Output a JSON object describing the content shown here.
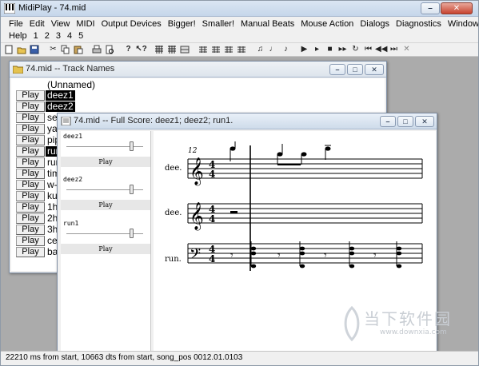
{
  "app": {
    "title": "MidiPlay - 74.mid",
    "colors": {
      "window_frame": "#c5d6ea",
      "mdi_background": "#ababab",
      "selection": "#000000"
    }
  },
  "menu": {
    "row1": [
      "File",
      "Edit",
      "View",
      "MIDI",
      "Output Devices",
      "Bigger!",
      "Smaller!",
      "Manual Beats",
      "Mouse Action",
      "Dialogs",
      "Diagnostics",
      "Window"
    ],
    "row2": [
      "Help",
      "1",
      "2",
      "3",
      "4",
      "5"
    ]
  },
  "toolbar": {
    "icons": [
      "new-icon",
      "open-icon",
      "save-icon",
      "cut-icon",
      "copy-icon",
      "paste-icon",
      "print-icon",
      "print-preview-icon",
      "help-icon",
      "context-help-icon",
      "piano-roll-icon",
      "score-icon",
      "staff-icon",
      "stave-icon",
      "bars-icon",
      "beats-icon",
      "notes-icon",
      "tempo-icon",
      "key-icon",
      "clef-icon",
      "play-icon",
      "step-forward-icon",
      "stop-icon",
      "fast-forward-icon",
      "loop-icon",
      "rewind-start-icon",
      "rewind-icon",
      "forward-end-icon",
      "close-icon"
    ]
  },
  "track_window": {
    "title": "74.mid -- Track Names",
    "play_label": "Play",
    "header": "(Unnamed)",
    "tracks": [
      {
        "name": "deez1",
        "selected": true
      },
      {
        "name": "deez2",
        "selected": true
      },
      {
        "name": "ser",
        "selected": false
      },
      {
        "name": "yac",
        "selected": false
      },
      {
        "name": "pip",
        "selected": false
      },
      {
        "name": "run",
        "selected": true
      },
      {
        "name": "run",
        "selected": false
      },
      {
        "name": "tim",
        "selected": false
      },
      {
        "name": "w-fi",
        "selected": false
      },
      {
        "name": "kua",
        "selected": false
      },
      {
        "name": "1hu",
        "selected": false
      },
      {
        "name": "2hu",
        "selected": false
      },
      {
        "name": "3hu",
        "selected": false
      },
      {
        "name": "cell",
        "selected": false
      },
      {
        "name": "bas",
        "selected": false
      }
    ]
  },
  "score_window": {
    "title": "74.mid -- Full Score: deez1; deez2; run1.",
    "play_label": "Play",
    "tracks": [
      {
        "name": "deez1",
        "volume": 0.88
      },
      {
        "name": "deez2",
        "volume": 0.88
      },
      {
        "name": "run1",
        "volume": 0.88
      }
    ],
    "measure_number": "12",
    "staff_labels": [
      "dee.",
      "dee.",
      "run."
    ],
    "time_signature": {
      "top": "4",
      "bottom": "4"
    }
  },
  "status_bar": {
    "text": "22210 ms from start, 10663 dts from start, song_pos 0012.01.0103"
  },
  "watermark": {
    "text": "当下软件园",
    "url": "www.downxia.com"
  }
}
